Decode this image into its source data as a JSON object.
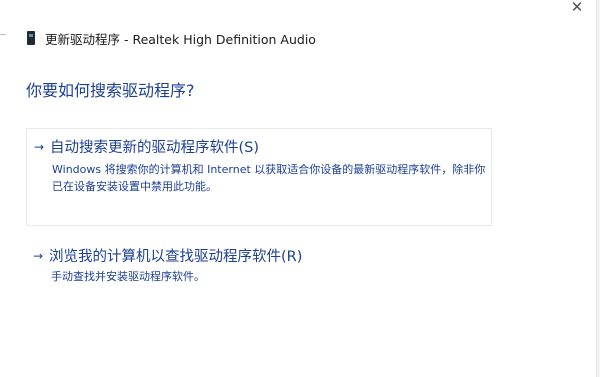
{
  "window": {
    "title": "更新驱动程序 - Realtek High Definition Audio",
    "close_glyph": "✕",
    "icon": "device-icon"
  },
  "heading": "你要如何搜索驱动程序?",
  "options": [
    {
      "arrow": "→",
      "title": "自动搜索更新的驱动程序软件(S)",
      "description": "Windows 将搜索你的计算机和 Internet 以获取适合你设备的最新驱动程序软件，除非你已在设备安装设置中禁用此功能。"
    },
    {
      "arrow": "→",
      "title": "浏览我的计算机以查找驱动程序软件(R)",
      "description": "手动查找并安装驱动程序软件。"
    }
  ],
  "colors": {
    "accent": "#1c3f94",
    "text": "#1b1b1b",
    "background": "#ffffff"
  }
}
